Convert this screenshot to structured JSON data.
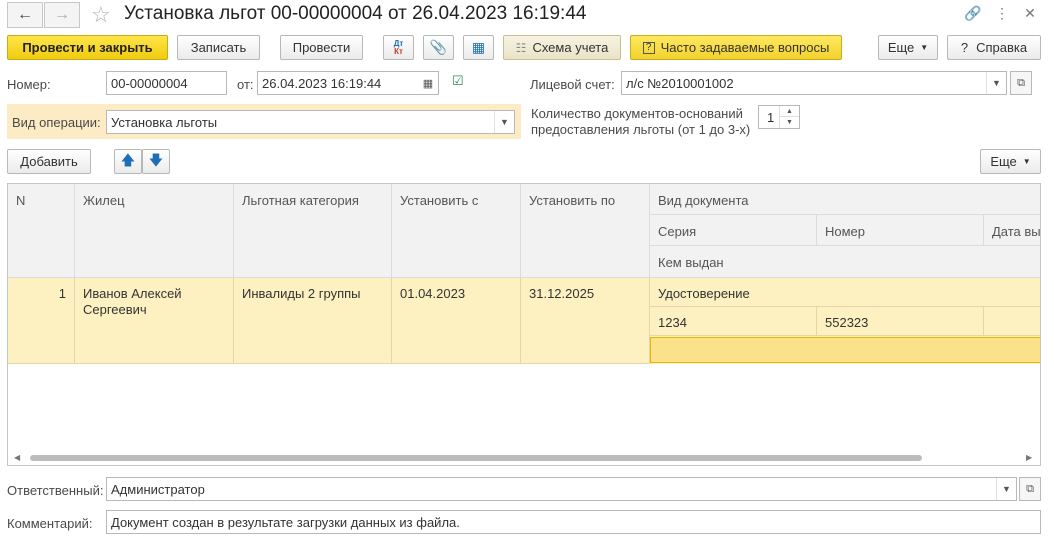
{
  "window": {
    "title": "Установка льгот 00-00000004 от 26.04.2023 16:19:44"
  },
  "toolbar": {
    "post_close_label": "Провести и закрыть",
    "save_label": "Записать",
    "post_label": "Провести",
    "dt_kt_label_top": "Дт",
    "dt_kt_label_bottom": "Кт",
    "scheme_label": "Схема учета",
    "faq_label": "Часто задаваемые вопросы",
    "more_label": "Еще",
    "help_label": "Справка"
  },
  "form": {
    "number_label": "Номер:",
    "number_value": "00-00000004",
    "from_label": "от:",
    "date_value": "26.04.2023 16:19:44",
    "account_label": "Лицевой счет:",
    "account_value": "л/с №2010001002",
    "operation_label": "Вид операции:",
    "operation_value": "Установка льготы",
    "docs_count_label_line1": "Количество документов-оснований",
    "docs_count_label_line2": "предоставления льготы (от 1 до 3-х)",
    "docs_count_value": "1"
  },
  "table_toolbar": {
    "add_label": "Добавить",
    "more_label": "Еще"
  },
  "table": {
    "headers": {
      "n": "N",
      "resident": "Жилец",
      "category": "Льготная категория",
      "from": "Установить с",
      "to": "Установить по",
      "doc_type": "Вид документа",
      "series": "Серия",
      "number": "Номер",
      "issue_date": "Дата вы",
      "issued_by": "Кем выдан"
    },
    "rows": [
      {
        "n": "1",
        "resident_line1": "Иванов Алексей",
        "resident_line2": "Сергеевич",
        "category": "Инвалиды 2 группы",
        "from": "01.04.2023",
        "to": "31.12.2025",
        "doc_type": "Удостоверение",
        "series": "1234",
        "number": "552323",
        "issue_date": "",
        "issued_by": ""
      }
    ]
  },
  "footer": {
    "responsible_label": "Ответственный:",
    "responsible_value": "Администратор",
    "comment_label": "Комментарий:",
    "comment_value": "Документ создан в результате загрузки данных из файла."
  },
  "colors": {
    "accent_yellow": "#f0cc0e",
    "selected_row": "#fdf1c2",
    "operation_panel": "#fcebc5"
  }
}
